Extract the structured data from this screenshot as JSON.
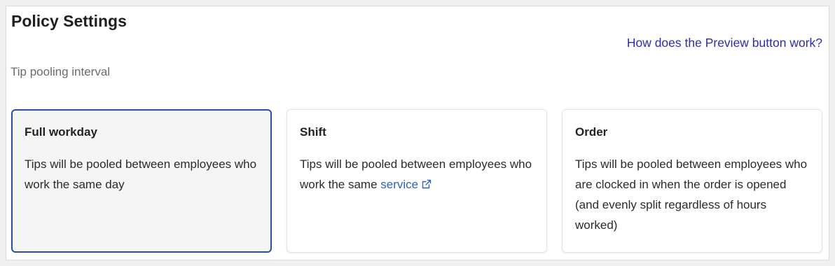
{
  "page": {
    "title": "Policy Settings",
    "help_link": "How does the Preview button work?",
    "subtitle": "Tip pooling interval"
  },
  "cards": [
    {
      "title": "Full workday",
      "description": "Tips will be pooled between employees who work the same day",
      "selected": true
    },
    {
      "title": "Shift",
      "description_prefix": "Tips will be pooled between employees who work the same",
      "link_text": "service",
      "link_icon": "external-link-icon",
      "selected": false
    },
    {
      "title": "Order",
      "description": "Tips will be pooled between employees who are clocked in when the order is opened (and evenly split regardless of hours worked)",
      "selected": false
    }
  ],
  "colors": {
    "selected_border": "#2b4fa0",
    "link": "#2d2cb0",
    "inline_link": "#2e63b8"
  }
}
